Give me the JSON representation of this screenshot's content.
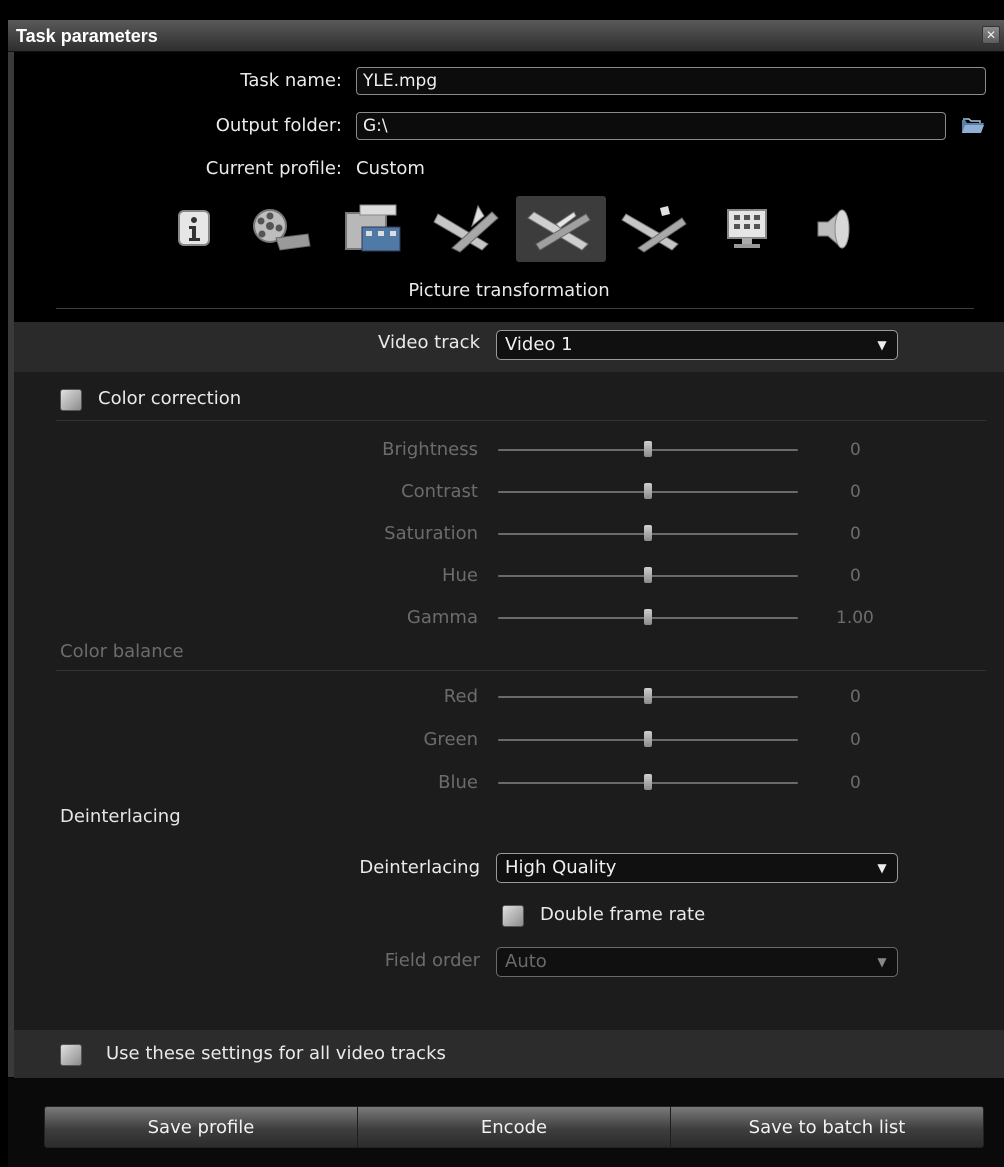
{
  "window": {
    "title": "Task parameters",
    "close_icon": "close-icon"
  },
  "task": {
    "name_label": "Task name:",
    "name_value": "YLE.mpg",
    "output_label": "Output folder:",
    "output_value": "G:\\",
    "profile_label": "Current profile:",
    "profile_value": "Custom"
  },
  "toolbar": {
    "icons": [
      "info-icon",
      "film-reel-icon",
      "film-crop-icon",
      "film-cut-icon",
      "picture-transformation-icon",
      "film-ruler-icon",
      "monitor-icon",
      "speaker-icon"
    ],
    "active_index": 4
  },
  "section": {
    "title": "Picture transformation"
  },
  "video_track": {
    "label": "Video track",
    "value": "Video 1"
  },
  "color_correction": {
    "label": "Color correction",
    "checked": true,
    "sliders": [
      {
        "label": "Brightness",
        "value": "0",
        "fraction": 0.5
      },
      {
        "label": "Contrast",
        "value": "0",
        "fraction": 0.5
      },
      {
        "label": "Saturation",
        "value": "0",
        "fraction": 0.5
      },
      {
        "label": "Hue",
        "value": "0",
        "fraction": 0.5
      },
      {
        "label": "Gamma",
        "value": "1.00",
        "fraction": 0.5
      }
    ]
  },
  "color_balance": {
    "header": "Color balance",
    "sliders": [
      {
        "label": "Red",
        "value": "0",
        "fraction": 0.5
      },
      {
        "label": "Green",
        "value": "0",
        "fraction": 0.5
      },
      {
        "label": "Blue",
        "value": "0",
        "fraction": 0.5
      }
    ]
  },
  "deinterlacing": {
    "header": "Deinterlacing",
    "label": "Deinterlacing",
    "value": "High Quality",
    "double_frame_rate_label": "Double frame rate",
    "field_order_label": "Field order",
    "field_order_value": "Auto"
  },
  "all_tracks": {
    "label": "Use these settings for all video tracks"
  },
  "buttons": {
    "save_profile": "Save profile",
    "encode": "Encode",
    "save_batch": "Save to batch list"
  }
}
